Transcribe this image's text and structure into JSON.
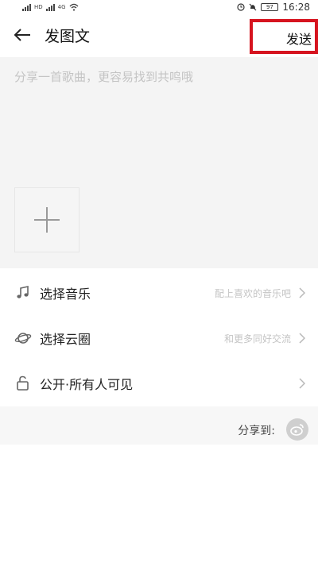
{
  "status_bar": {
    "left_text_1": "HD",
    "left_text_2": "4G",
    "battery": "97",
    "time": "16:28"
  },
  "header": {
    "title": "发图文",
    "send_label": "发送",
    "back_icon": "arrow-left-icon"
  },
  "compose": {
    "placeholder": "分享一首歌曲，更容易找到共鸣哦",
    "add_icon": "plus-icon"
  },
  "options": [
    {
      "label": "选择音乐",
      "hint": "配上喜欢的音乐吧",
      "icon": "music-note-icon"
    },
    {
      "label": "选择云圈",
      "hint": "和更多同好交流",
      "icon": "planet-icon"
    },
    {
      "label": "公开·所有人可见",
      "hint": "",
      "icon": "unlock-icon"
    }
  ],
  "share": {
    "label": "分享到:",
    "weibo_icon": "weibo-icon"
  },
  "colors": {
    "highlight_border": "#d6141f",
    "compose_bg": "#f4f4f4",
    "hint_text": "#c4c4c4"
  }
}
